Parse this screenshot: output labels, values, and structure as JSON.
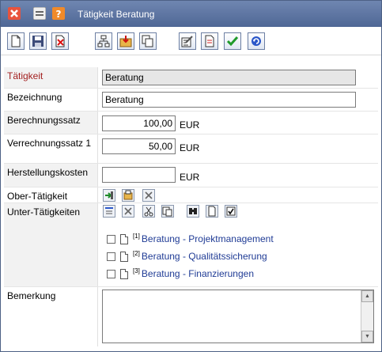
{
  "window": {
    "title": "Tätigkeit Beratung"
  },
  "titlebar_icons": [
    "close-icon",
    "minimize-icon",
    "help-icon"
  ],
  "toolbar": {
    "buttons": [
      "new-document",
      "save",
      "delete",
      "structure",
      "import",
      "copy",
      "properties",
      "print",
      "confirm",
      "refresh"
    ]
  },
  "fields": {
    "taetigkeit": {
      "label": "Tätigkeit",
      "value": "Beratung"
    },
    "bezeichnung": {
      "label": "Bezeichnung",
      "value": "Beratung"
    },
    "berechnungssatz": {
      "label": "Berechnungssatz",
      "value": "100,00",
      "unit": "EUR"
    },
    "verrechnungssatz": {
      "label": "Verrechnungssatz 1",
      "value": "50,00",
      "unit": "EUR"
    },
    "herstellungskosten": {
      "label": "Herstellungskosten",
      "value": "",
      "unit": "EUR"
    },
    "ober": {
      "label": "Ober-Tätigkeit"
    },
    "unter": {
      "label": "Unter-Tätigkeiten"
    },
    "bemerkung": {
      "label": "Bemerkung",
      "value": ""
    }
  },
  "sub_items": [
    {
      "num": "[1]",
      "label": "Beratung - Projektmanagement"
    },
    {
      "num": "[2]",
      "label": "Beratung - Qualitätssicherung"
    },
    {
      "num": "[3]",
      "label": "Beratung - Finanzierungen"
    }
  ],
  "colors": {
    "titlebar": "#5a719d",
    "required_label": "#a32020",
    "link": "#1f3b95"
  }
}
